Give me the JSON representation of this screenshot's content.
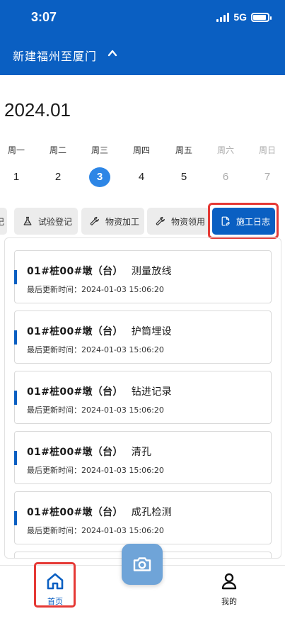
{
  "status_bar": {
    "time": "3:07",
    "network": "5G"
  },
  "header": {
    "project_title": "新建福州至厦门"
  },
  "calendar": {
    "month": "2024.01",
    "days": [
      {
        "weekday": "周一",
        "date": "1",
        "selected": false,
        "weekend": false
      },
      {
        "weekday": "周二",
        "date": "2",
        "selected": false,
        "weekend": false
      },
      {
        "weekday": "周三",
        "date": "3",
        "selected": true,
        "weekend": false
      },
      {
        "weekday": "周四",
        "date": "4",
        "selected": false,
        "weekend": false
      },
      {
        "weekday": "周五",
        "date": "5",
        "selected": false,
        "weekend": false
      },
      {
        "weekday": "周六",
        "date": "6",
        "selected": false,
        "weekend": true
      },
      {
        "weekday": "周日",
        "date": "7",
        "selected": false,
        "weekend": true
      }
    ]
  },
  "tabs": [
    {
      "label": "记",
      "icon": "document-icon",
      "active": false
    },
    {
      "label": "试验登记",
      "icon": "flask-icon",
      "active": false
    },
    {
      "label": "物资加工",
      "icon": "wrench-icon",
      "active": false
    },
    {
      "label": "物资领用",
      "icon": "wrench-icon",
      "active": false
    },
    {
      "label": "施工日志",
      "icon": "document-edit-icon",
      "active": true
    }
  ],
  "records": [
    {
      "location": "01#桩00#墩（台）",
      "task": "测量放线",
      "updated_label": "最后更新时间：",
      "updated_at": "2024-01-03 15:06:20"
    },
    {
      "location": "01#桩00#墩（台）",
      "task": "护筒埋设",
      "updated_label": "最后更新时间：",
      "updated_at": "2024-01-03 15:06:20"
    },
    {
      "location": "01#桩00#墩（台）",
      "task": "钻进记录",
      "updated_label": "最后更新时间：",
      "updated_at": "2024-01-03 15:06:20"
    },
    {
      "location": "01#桩00#墩（台）",
      "task": "清孔",
      "updated_label": "最后更新时间：",
      "updated_at": "2024-01-03 15:06:20"
    },
    {
      "location": "01#桩00#墩（台）",
      "task": "成孔检测",
      "updated_label": "最后更新时间：",
      "updated_at": "2024-01-03 15:06:20"
    }
  ],
  "bottom_nav": {
    "home_label": "首页",
    "mine_label": "我的"
  },
  "colors": {
    "primary": "#0a5fc2",
    "selected_day": "#2d86e6",
    "highlight_frame": "#e53935",
    "camera_button": "#6fa4d8"
  }
}
